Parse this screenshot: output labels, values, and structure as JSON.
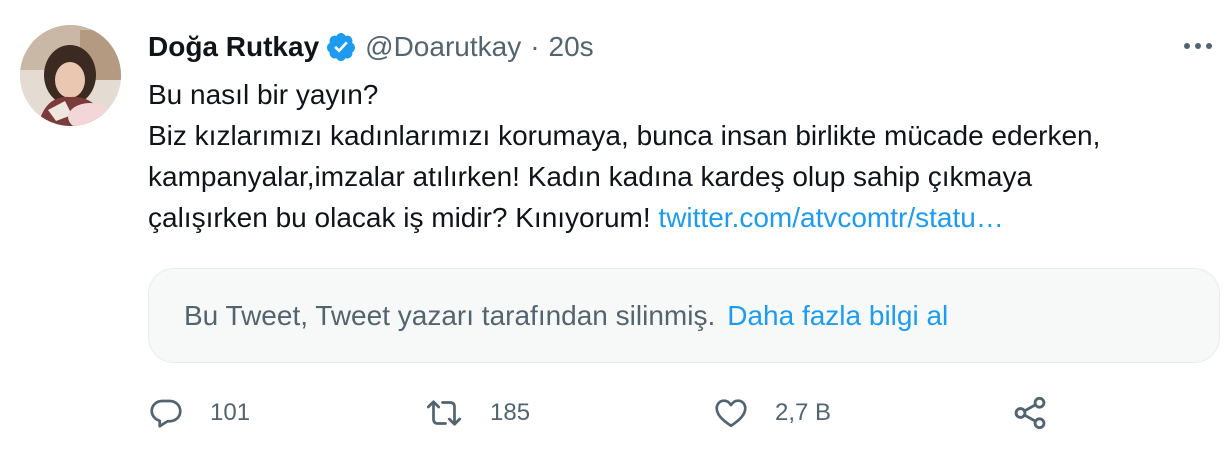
{
  "tweet": {
    "author": {
      "display_name": "Doğa Rutkay",
      "handle": "@Doarutkay",
      "verified": true
    },
    "separator": "·",
    "timestamp": "20s",
    "text_lines": [
      "Bu nasıl bir yayın?",
      "Biz kızlarımızı kadınlarımızı korumaya, bunca insan birlikte mücade ederken,",
      "kampanyalar,imzalar atılırken! Kadın kadına kardeş olup sahip çıkmaya",
      "çalışırken bu olacak iş midir? Kınıyorum! "
    ],
    "link_text": "twitter.com/atvcomtr/statu…",
    "quoted": {
      "message": "Bu Tweet, Tweet yazarı tarafından silinmiş.",
      "link": "Daha fazla bilgi al"
    },
    "actions": {
      "reply_count": "101",
      "retweet_count": "185",
      "like_count": "2,7 B"
    }
  },
  "colors": {
    "text": "#0f1419",
    "secondary": "#536471",
    "link": "#1d9bf0",
    "verified": "#1d9bf0",
    "quote_bg": "#f7f9f9"
  },
  "icons": [
    "verified-badge-icon",
    "more-icon",
    "reply-icon",
    "retweet-icon",
    "like-icon",
    "share-icon"
  ]
}
